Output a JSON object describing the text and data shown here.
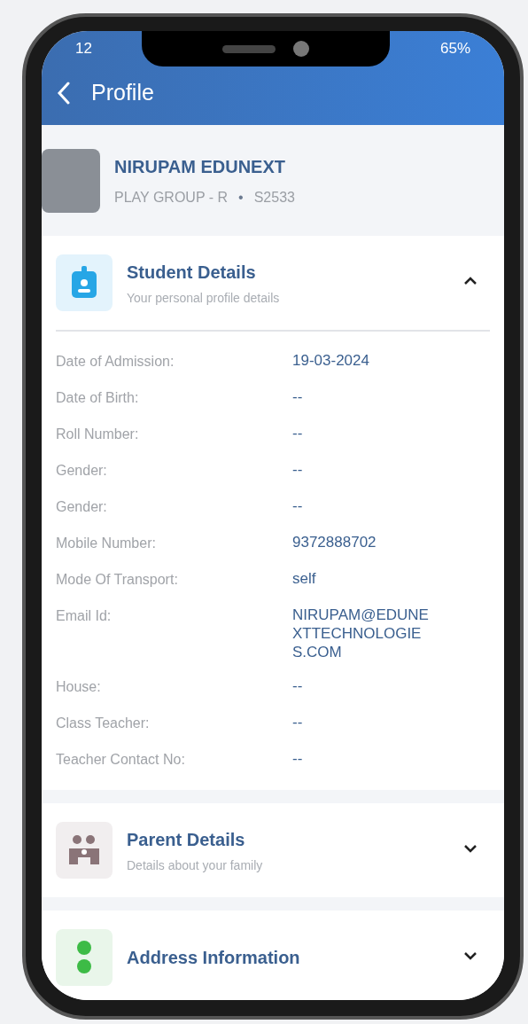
{
  "status_bar": {
    "time": "12",
    "battery": "65%"
  },
  "header": {
    "title": "Profile"
  },
  "profile": {
    "name": "NIRUPAM EDUNEXT",
    "class": "PLAY GROUP - R",
    "separator": "•",
    "id": "S2533"
  },
  "sections": [
    {
      "kind": "student",
      "title": "Student Details",
      "subtitle": "Your personal profile details",
      "expanded": true,
      "fields": [
        {
          "label": "Date of Admission:",
          "value": "19-03-2024"
        },
        {
          "label": "Date of Birth:",
          "value": "--"
        },
        {
          "label": "Roll Number:",
          "value": "--"
        },
        {
          "label": "Gender:",
          "value": "--"
        },
        {
          "label": "Gender:",
          "value": "--"
        },
        {
          "label": "Mobile Number:",
          "value": "9372888702"
        },
        {
          "label": "Mode Of Transport:",
          "value": "self"
        },
        {
          "label": "Email Id:",
          "value": "NIRUPAM@EDUNEXTTECHNOLOGIES.COM"
        },
        {
          "label": "House:",
          "value": "--"
        },
        {
          "label": "Class Teacher:",
          "value": "--"
        },
        {
          "label": "Teacher Contact No:",
          "value": "--"
        }
      ]
    },
    {
      "kind": "parent",
      "title": "Parent Details",
      "subtitle": "Details about your family",
      "expanded": false
    },
    {
      "kind": "address",
      "title": "Address Information",
      "expanded": false
    }
  ]
}
